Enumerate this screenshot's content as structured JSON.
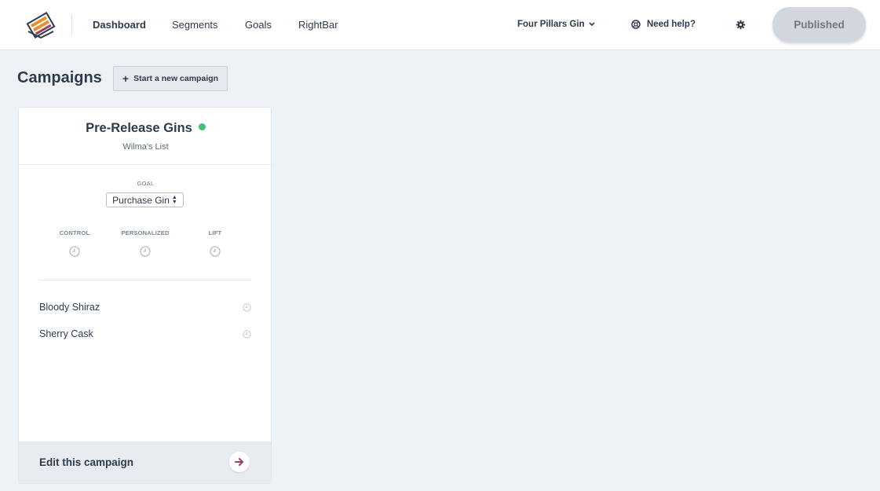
{
  "nav": {
    "items": [
      {
        "label": "Dashboard",
        "active": true
      },
      {
        "label": "Segments",
        "active": false
      },
      {
        "label": "Goals",
        "active": false
      },
      {
        "label": "RightBar",
        "active": false
      }
    ],
    "account": "Four Pillars Gin",
    "help": "Need help?",
    "publish_button": "Published"
  },
  "page": {
    "title": "Campaigns",
    "new_campaign_button": "Start a new campaign"
  },
  "campaign": {
    "name": "Pre-Release Gins",
    "status_color": "#3cc36f",
    "list_name": "Wilma's List",
    "goal_label": "GOAL",
    "goal_value": "Purchase Gin",
    "metrics": [
      {
        "label": "CONTROL",
        "icon": "clock-icon"
      },
      {
        "label": "PERSONALIZED",
        "icon": "clock-icon"
      },
      {
        "label": "LIFT",
        "icon": "clock-icon"
      }
    ],
    "variants": [
      {
        "label": "Bloody Shiraz",
        "icon": "clock-icon"
      },
      {
        "label": "Sherry Cask",
        "icon": "clock-icon"
      }
    ],
    "edit_label": "Edit this campaign"
  },
  "colors": {
    "accent": "#a03a63",
    "logo_orange": "#e8902c",
    "text": "#2e3a4d",
    "background": "#eff2f5"
  }
}
